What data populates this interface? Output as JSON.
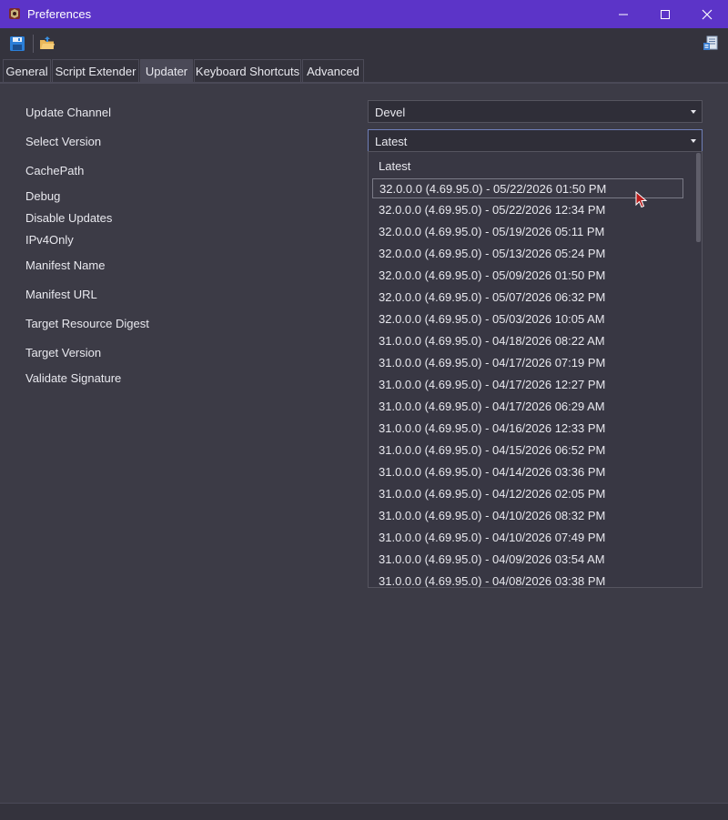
{
  "window": {
    "title": "Preferences",
    "icon": "app-icon",
    "controls": [
      "minimize-icon",
      "maximize-icon",
      "close-icon"
    ]
  },
  "toolbar": {
    "buttons": [
      "save-icon",
      "open-folder-icon",
      "document-export-icon"
    ]
  },
  "tabs": [
    {
      "label": "General",
      "active": false
    },
    {
      "label": "Script Extender",
      "active": false
    },
    {
      "label": "Updater",
      "active": true
    },
    {
      "label": "Keyboard Shortcuts",
      "active": false
    },
    {
      "label": "Advanced",
      "active": false
    }
  ],
  "settings": {
    "update_channel": {
      "label": "Update Channel",
      "value": "Devel"
    },
    "select_version": {
      "label": "Select Version",
      "value": "Latest"
    },
    "cache_path": {
      "label": "CachePath"
    },
    "debug": {
      "label": "Debug"
    },
    "disable_updates": {
      "label": "Disable Updates"
    },
    "ipv4only": {
      "label": "IPv4Only"
    },
    "manifest_name": {
      "label": "Manifest Name"
    },
    "manifest_url": {
      "label": "Manifest URL"
    },
    "target_resource_digest": {
      "label": "Target Resource Digest"
    },
    "target_version": {
      "label": "Target Version"
    },
    "validate_signature": {
      "label": "Validate Signature"
    }
  },
  "version_dropdown": {
    "highlighted_index": 1,
    "options": [
      "Latest",
      "32.0.0.0 (4.69.95.0) - 05/22/2026 01:50 PM",
      "32.0.0.0 (4.69.95.0) - 05/22/2026 12:34 PM",
      "32.0.0.0 (4.69.95.0) - 05/19/2026 05:11 PM",
      "32.0.0.0 (4.69.95.0) - 05/13/2026 05:24 PM",
      "32.0.0.0 (4.69.95.0) - 05/09/2026 01:50 PM",
      "32.0.0.0 (4.69.95.0) - 05/07/2026 06:32 PM",
      "32.0.0.0 (4.69.95.0) - 05/03/2026 10:05 AM",
      "31.0.0.0 (4.69.95.0) - 04/18/2026 08:22 AM",
      "31.0.0.0 (4.69.95.0) - 04/17/2026 07:19 PM",
      "31.0.0.0 (4.69.95.0) - 04/17/2026 12:27 PM",
      "31.0.0.0 (4.69.95.0) - 04/17/2026 06:29 AM",
      "31.0.0.0 (4.69.95.0) - 04/16/2026 12:33 PM",
      "31.0.0.0 (4.69.95.0) - 04/15/2026 06:52 PM",
      "31.0.0.0 (4.69.95.0) - 04/14/2026 03:36 PM",
      "31.0.0.0 (4.69.95.0) - 04/12/2026 02:05 PM",
      "31.0.0.0 (4.69.95.0) - 04/10/2026 08:32 PM",
      "31.0.0.0 (4.69.95.0) - 04/10/2026 07:49 PM",
      "31.0.0.0 (4.69.95.0) - 04/09/2026 03:54 AM",
      "31.0.0.0 (4.69.95.0) - 04/08/2026 03:38 PM"
    ]
  },
  "colors": {
    "titlebar": "#5c34c8",
    "background": "#3c3b46",
    "accent_focus": "#6f7fb8"
  }
}
